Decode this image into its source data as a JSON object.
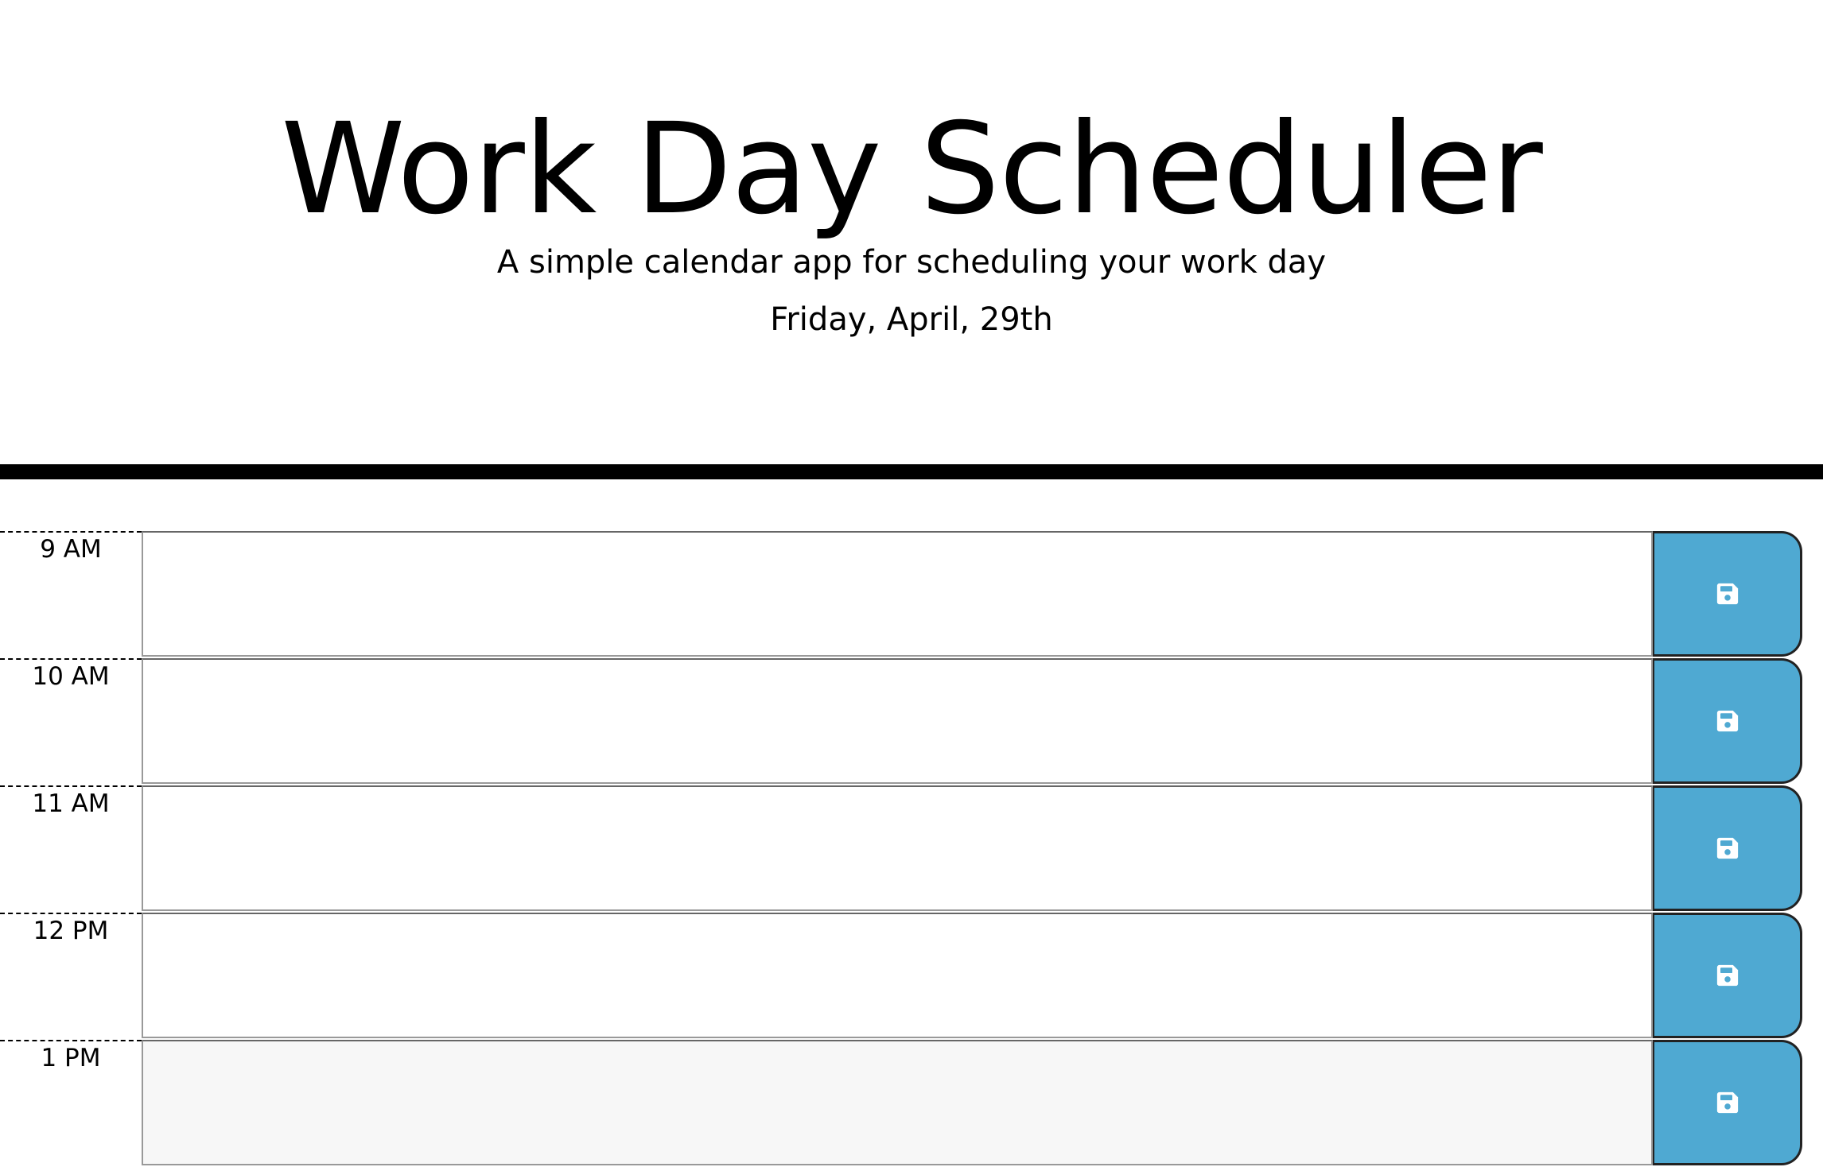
{
  "header": {
    "title": "Work Day Scheduler",
    "subtitle": "A simple calendar app for scheduling your work day",
    "current_day": "Friday, April, 29th"
  },
  "colors": {
    "save_button": "#4fa9d2",
    "divider": "#000000"
  },
  "time_blocks": [
    {
      "hour": "9 AM",
      "description": "",
      "save_icon": "floppy-disk-icon"
    },
    {
      "hour": "10 AM",
      "description": "",
      "save_icon": "floppy-disk-icon"
    },
    {
      "hour": "11 AM",
      "description": "",
      "save_icon": "floppy-disk-icon"
    },
    {
      "hour": "12 PM",
      "description": "",
      "save_icon": "floppy-disk-icon"
    },
    {
      "hour": "1 PM",
      "description": "",
      "save_icon": "floppy-disk-icon"
    }
  ]
}
